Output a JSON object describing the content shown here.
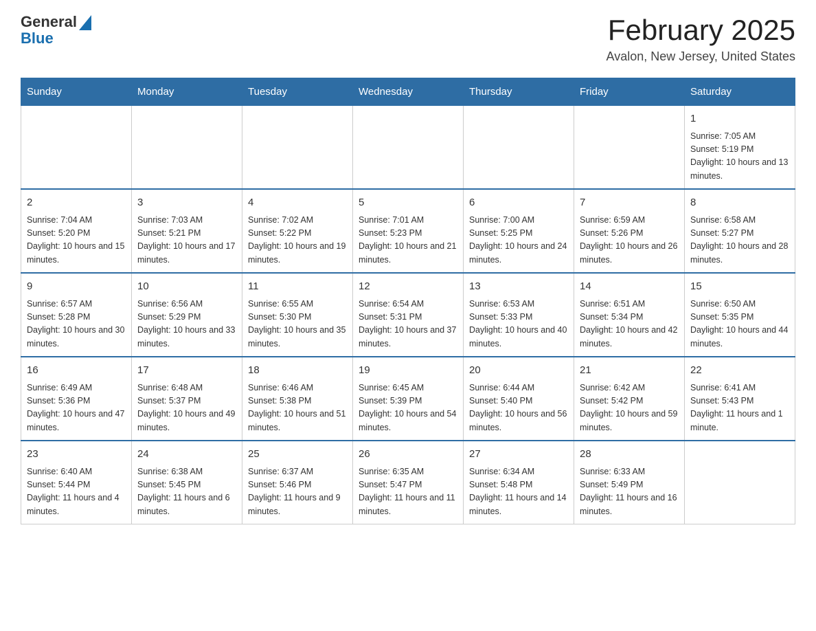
{
  "logo": {
    "general": "General",
    "blue": "Blue"
  },
  "header": {
    "month_title": "February 2025",
    "location": "Avalon, New Jersey, United States"
  },
  "days_of_week": [
    "Sunday",
    "Monday",
    "Tuesday",
    "Wednesday",
    "Thursday",
    "Friday",
    "Saturday"
  ],
  "weeks": [
    [
      {
        "day": "",
        "info": ""
      },
      {
        "day": "",
        "info": ""
      },
      {
        "day": "",
        "info": ""
      },
      {
        "day": "",
        "info": ""
      },
      {
        "day": "",
        "info": ""
      },
      {
        "day": "",
        "info": ""
      },
      {
        "day": "1",
        "info": "Sunrise: 7:05 AM\nSunset: 5:19 PM\nDaylight: 10 hours and 13 minutes."
      }
    ],
    [
      {
        "day": "2",
        "info": "Sunrise: 7:04 AM\nSunset: 5:20 PM\nDaylight: 10 hours and 15 minutes."
      },
      {
        "day": "3",
        "info": "Sunrise: 7:03 AM\nSunset: 5:21 PM\nDaylight: 10 hours and 17 minutes."
      },
      {
        "day": "4",
        "info": "Sunrise: 7:02 AM\nSunset: 5:22 PM\nDaylight: 10 hours and 19 minutes."
      },
      {
        "day": "5",
        "info": "Sunrise: 7:01 AM\nSunset: 5:23 PM\nDaylight: 10 hours and 21 minutes."
      },
      {
        "day": "6",
        "info": "Sunrise: 7:00 AM\nSunset: 5:25 PM\nDaylight: 10 hours and 24 minutes."
      },
      {
        "day": "7",
        "info": "Sunrise: 6:59 AM\nSunset: 5:26 PM\nDaylight: 10 hours and 26 minutes."
      },
      {
        "day": "8",
        "info": "Sunrise: 6:58 AM\nSunset: 5:27 PM\nDaylight: 10 hours and 28 minutes."
      }
    ],
    [
      {
        "day": "9",
        "info": "Sunrise: 6:57 AM\nSunset: 5:28 PM\nDaylight: 10 hours and 30 minutes."
      },
      {
        "day": "10",
        "info": "Sunrise: 6:56 AM\nSunset: 5:29 PM\nDaylight: 10 hours and 33 minutes."
      },
      {
        "day": "11",
        "info": "Sunrise: 6:55 AM\nSunset: 5:30 PM\nDaylight: 10 hours and 35 minutes."
      },
      {
        "day": "12",
        "info": "Sunrise: 6:54 AM\nSunset: 5:31 PM\nDaylight: 10 hours and 37 minutes."
      },
      {
        "day": "13",
        "info": "Sunrise: 6:53 AM\nSunset: 5:33 PM\nDaylight: 10 hours and 40 minutes."
      },
      {
        "day": "14",
        "info": "Sunrise: 6:51 AM\nSunset: 5:34 PM\nDaylight: 10 hours and 42 minutes."
      },
      {
        "day": "15",
        "info": "Sunrise: 6:50 AM\nSunset: 5:35 PM\nDaylight: 10 hours and 44 minutes."
      }
    ],
    [
      {
        "day": "16",
        "info": "Sunrise: 6:49 AM\nSunset: 5:36 PM\nDaylight: 10 hours and 47 minutes."
      },
      {
        "day": "17",
        "info": "Sunrise: 6:48 AM\nSunset: 5:37 PM\nDaylight: 10 hours and 49 minutes."
      },
      {
        "day": "18",
        "info": "Sunrise: 6:46 AM\nSunset: 5:38 PM\nDaylight: 10 hours and 51 minutes."
      },
      {
        "day": "19",
        "info": "Sunrise: 6:45 AM\nSunset: 5:39 PM\nDaylight: 10 hours and 54 minutes."
      },
      {
        "day": "20",
        "info": "Sunrise: 6:44 AM\nSunset: 5:40 PM\nDaylight: 10 hours and 56 minutes."
      },
      {
        "day": "21",
        "info": "Sunrise: 6:42 AM\nSunset: 5:42 PM\nDaylight: 10 hours and 59 minutes."
      },
      {
        "day": "22",
        "info": "Sunrise: 6:41 AM\nSunset: 5:43 PM\nDaylight: 11 hours and 1 minute."
      }
    ],
    [
      {
        "day": "23",
        "info": "Sunrise: 6:40 AM\nSunset: 5:44 PM\nDaylight: 11 hours and 4 minutes."
      },
      {
        "day": "24",
        "info": "Sunrise: 6:38 AM\nSunset: 5:45 PM\nDaylight: 11 hours and 6 minutes."
      },
      {
        "day": "25",
        "info": "Sunrise: 6:37 AM\nSunset: 5:46 PM\nDaylight: 11 hours and 9 minutes."
      },
      {
        "day": "26",
        "info": "Sunrise: 6:35 AM\nSunset: 5:47 PM\nDaylight: 11 hours and 11 minutes."
      },
      {
        "day": "27",
        "info": "Sunrise: 6:34 AM\nSunset: 5:48 PM\nDaylight: 11 hours and 14 minutes."
      },
      {
        "day": "28",
        "info": "Sunrise: 6:33 AM\nSunset: 5:49 PM\nDaylight: 11 hours and 16 minutes."
      },
      {
        "day": "",
        "info": ""
      }
    ]
  ]
}
